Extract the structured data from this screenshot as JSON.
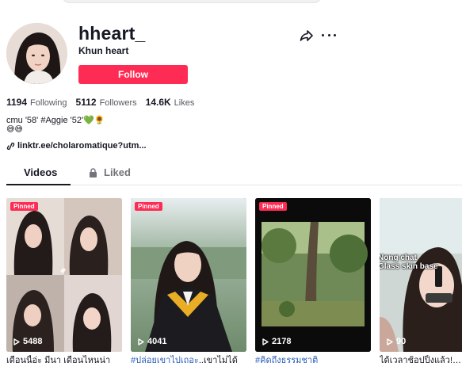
{
  "profile": {
    "username": "hheart_",
    "nickname": "Khun heart",
    "follow_label": "Follow",
    "bio": "cmu '58' #Aggie '52'💚🌻",
    "bio_emoji": "😅😅",
    "link": "linktr.ee/cholaromatique?utm..."
  },
  "stats": [
    {
      "value": "1194",
      "label": "Following"
    },
    {
      "value": "5112",
      "label": "Followers"
    },
    {
      "value": "14.6K",
      "label": "Likes"
    }
  ],
  "tabs": {
    "videos": "Videos",
    "liked": "Liked"
  },
  "videos": [
    {
      "pinned": "Pinned",
      "views": "5488",
      "caption": "เดือนนี้อ่ะ มีนา เดือนไหนน่า"
    },
    {
      "pinned": "Pinned",
      "views": "4041",
      "caption_tag": "#ปล่อยเขาไปเถอะ",
      "caption_rest": "..เขาไม่ได้"
    },
    {
      "pinned": "Pinned",
      "views": "2178",
      "caption_tag": "#คิดถึงธรรมชาติ",
      "caption_rest": ""
    },
    {
      "views": "90",
      "overlay": "Nong chat\nGlass skin base",
      "caption": "ได้เวลาช้อปปิ้งแล้ว!💄✅"
    }
  ],
  "colors": {
    "accent": "#fe2c55",
    "link_tag": "#2b5db9",
    "text": "#161823",
    "muted": "#57585f"
  },
  "icons": [
    "share-icon",
    "more-icon",
    "link-icon",
    "lock-icon",
    "play-icon"
  ]
}
